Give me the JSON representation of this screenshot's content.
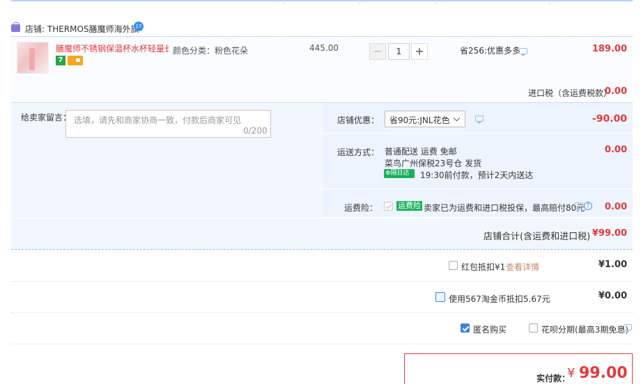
{
  "shop": {
    "label": "店铺: THERMOS膳魔师海外旗",
    "badge": "17"
  },
  "item": {
    "title": "膳魔师不锈钢保温杯水杯轻量长...",
    "tag": "7",
    "variant": "颜色分类：粉色花朵",
    "unit_price": "445.00",
    "quantity": "1",
    "minus": "−",
    "plus": "+",
    "promo": "省256:优惠多多",
    "total": "189.00"
  },
  "tax": {
    "label": "进口税（含运费税款）",
    "value": "0.00"
  },
  "notes": {
    "label": "给卖家留言：",
    "placeholder": "选填，请先和商家协商一致，付款后商家可见",
    "count": "0/200"
  },
  "discount": {
    "label": "店铺优惠：",
    "selected": "省90元:JNL花色",
    "value": "-90.00"
  },
  "shipping": {
    "label": "运送方式：",
    "method": "普通配送 运费 免邮",
    "warehouse": "菜鸟广州保税23号仓  发货",
    "tag": "隔日达",
    "eta": "19:30前付款，预计2天内送达",
    "value": "0.00"
  },
  "insurance": {
    "label": "运费险：",
    "badge": "运费险",
    "text": "卖家已为运费和进口税投保，最高赔付80元",
    "help": "?",
    "value": "0.00"
  },
  "subtotal": {
    "label": "店铺合计(含运费和进口税)",
    "value": "¥99.00"
  },
  "redpacket": {
    "label": "红包抵扣¥1",
    "link": "查看详情",
    "value": "¥1.00"
  },
  "coins": {
    "label": "使用567淘金币抵扣5.67元",
    "value": "¥0.00"
  },
  "anonymous": {
    "label": "匿名购买"
  },
  "huabei": {
    "label": "花呗分期(最高3期免息)"
  },
  "final": {
    "label": "实付款：",
    "currency": "¥",
    "value": "99.00"
  }
}
